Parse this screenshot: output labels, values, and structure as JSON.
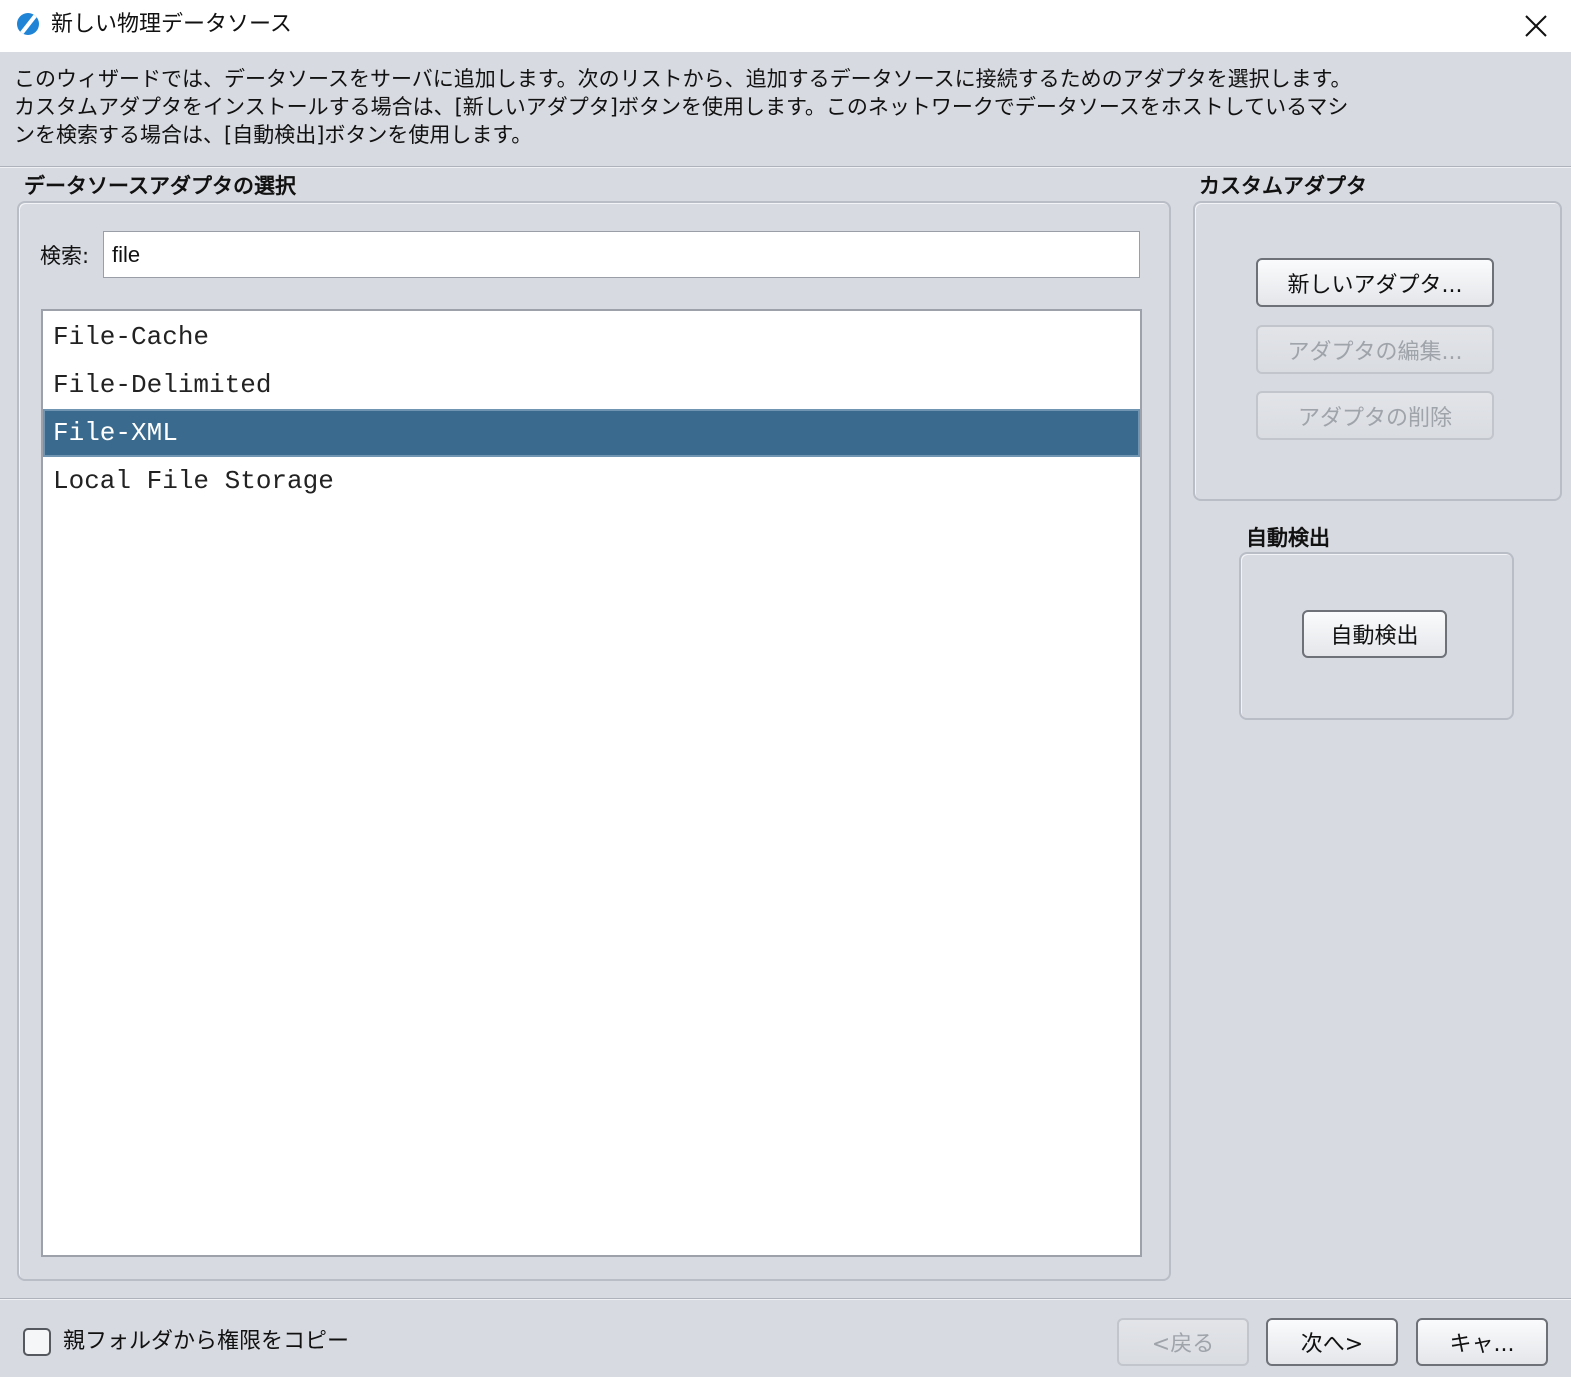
{
  "window": {
    "title": "新しい物理データソース",
    "icon": "app-logo-icon",
    "close_icon": "close-icon"
  },
  "description": "このウィザードでは、データソースをサーバに追加します。次のリストから、追加するデータソースに接続するためのアダプタを選択します。\nカスタムアダプタをインストールする場合は、[新しいアダプタ]ボタンを使用します。このネットワークでデータソースをホストしているマシ\nンを検索する場合は、[自動検出]ボタンを使用します。",
  "adapter_group": {
    "title": "データソースアダプタの選択",
    "search_label": "検索:",
    "search_value": "file",
    "items": [
      {
        "label": "File-Cache",
        "selected": false
      },
      {
        "label": "File-Delimited",
        "selected": false
      },
      {
        "label": "File-XML",
        "selected": true
      },
      {
        "label": "Local File Storage",
        "selected": false
      }
    ]
  },
  "custom_group": {
    "title": "カスタムアダプタ",
    "new_button": "新しいアダプタ...",
    "edit_button": "アダプタの編集...",
    "delete_button": "アダプタの削除"
  },
  "detect_group": {
    "title": "自動検出",
    "button": "自動検出"
  },
  "footer": {
    "checkbox_label": "親フォルダから権限をコピー",
    "checkbox_checked": false,
    "back_button": "<戻る",
    "next_button": "次へ>",
    "cancel_button": "キャ..."
  },
  "colors": {
    "background": "#d7dae1",
    "selection": "#3a6a8d",
    "app_icon": "#1f84d6"
  }
}
